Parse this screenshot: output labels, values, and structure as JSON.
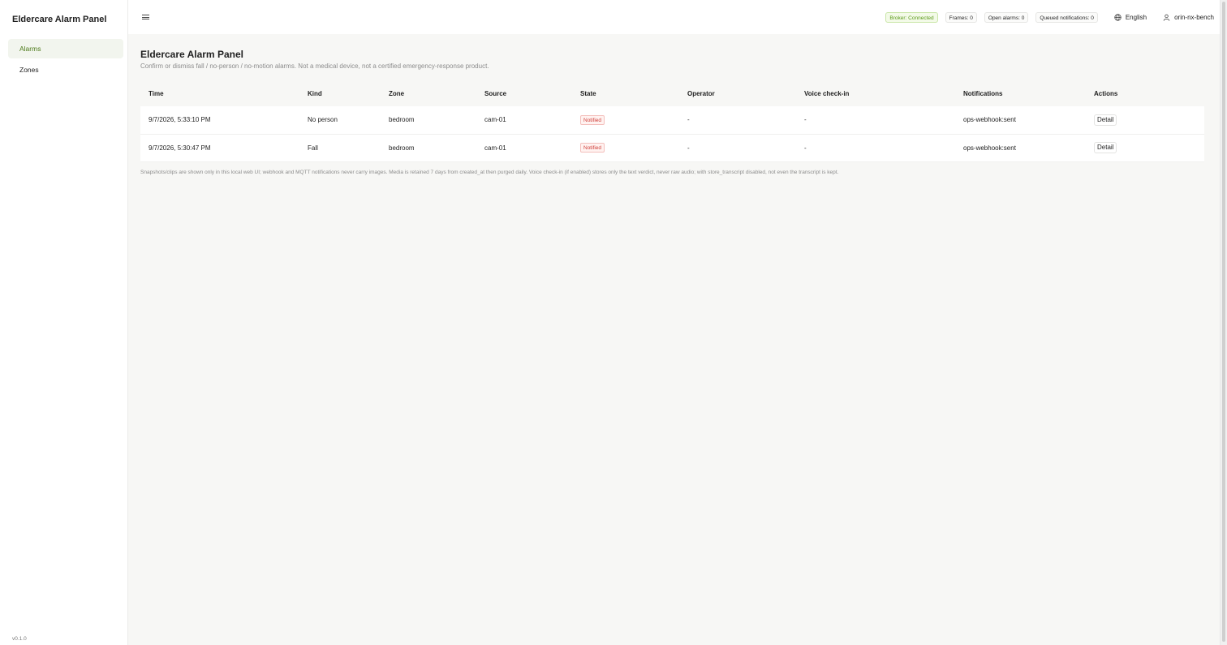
{
  "app": {
    "title": "Eldercare Alarm Panel",
    "version": "v0.1.0"
  },
  "sidebar": {
    "items": [
      {
        "label": "Alarms",
        "active": true
      },
      {
        "label": "Zones",
        "active": false
      }
    ]
  },
  "header": {
    "status": {
      "broker": "Broker: Connected",
      "frames": "Frames: 0",
      "open_alarms": "Open alarms: 0",
      "queued": "Queued notifications: 0"
    },
    "language": "English",
    "user": "orin-nx-bench"
  },
  "page": {
    "title": "Eldercare Alarm Panel",
    "subtitle": "Confirm or dismiss fall / no-person / no-motion alarms. Not a medical device, not a certified emergency-response product."
  },
  "table": {
    "columns": [
      "Time",
      "Kind",
      "Zone",
      "Source",
      "State",
      "Operator",
      "Voice check-in",
      "Notifications",
      "Actions"
    ],
    "rows": [
      {
        "time": "9/7/2026, 5:33:10 PM",
        "kind": "No person",
        "zone": "bedroom",
        "source": "cam-01",
        "state": "Notified",
        "operator": "-",
        "voice": "-",
        "notifications": "ops-webhook:sent",
        "action": "Detail"
      },
      {
        "time": "9/7/2026, 5:30:47 PM",
        "kind": "Fall",
        "zone": "bedroom",
        "source": "cam-01",
        "state": "Notified",
        "operator": "-",
        "voice": "-",
        "notifications": "ops-webhook:sent",
        "action": "Detail"
      }
    ]
  },
  "footnote": "Snapshots/clips are shown only in this local web UI; webhook and MQTT notifications never carry images. Media is retained 7 days from created_at then purged daily. Voice check-in (if enabled) stores only the text verdict, never raw audio; with store_transcript disabled, not even the transcript is kept.",
  "colors": {
    "accent": "#4d7a1a",
    "ok": "#5b9a1a",
    "alert": "#cf3f3a"
  },
  "icons": {
    "menu": "hamburger-icon",
    "language": "globe-icon",
    "user": "user-icon"
  }
}
